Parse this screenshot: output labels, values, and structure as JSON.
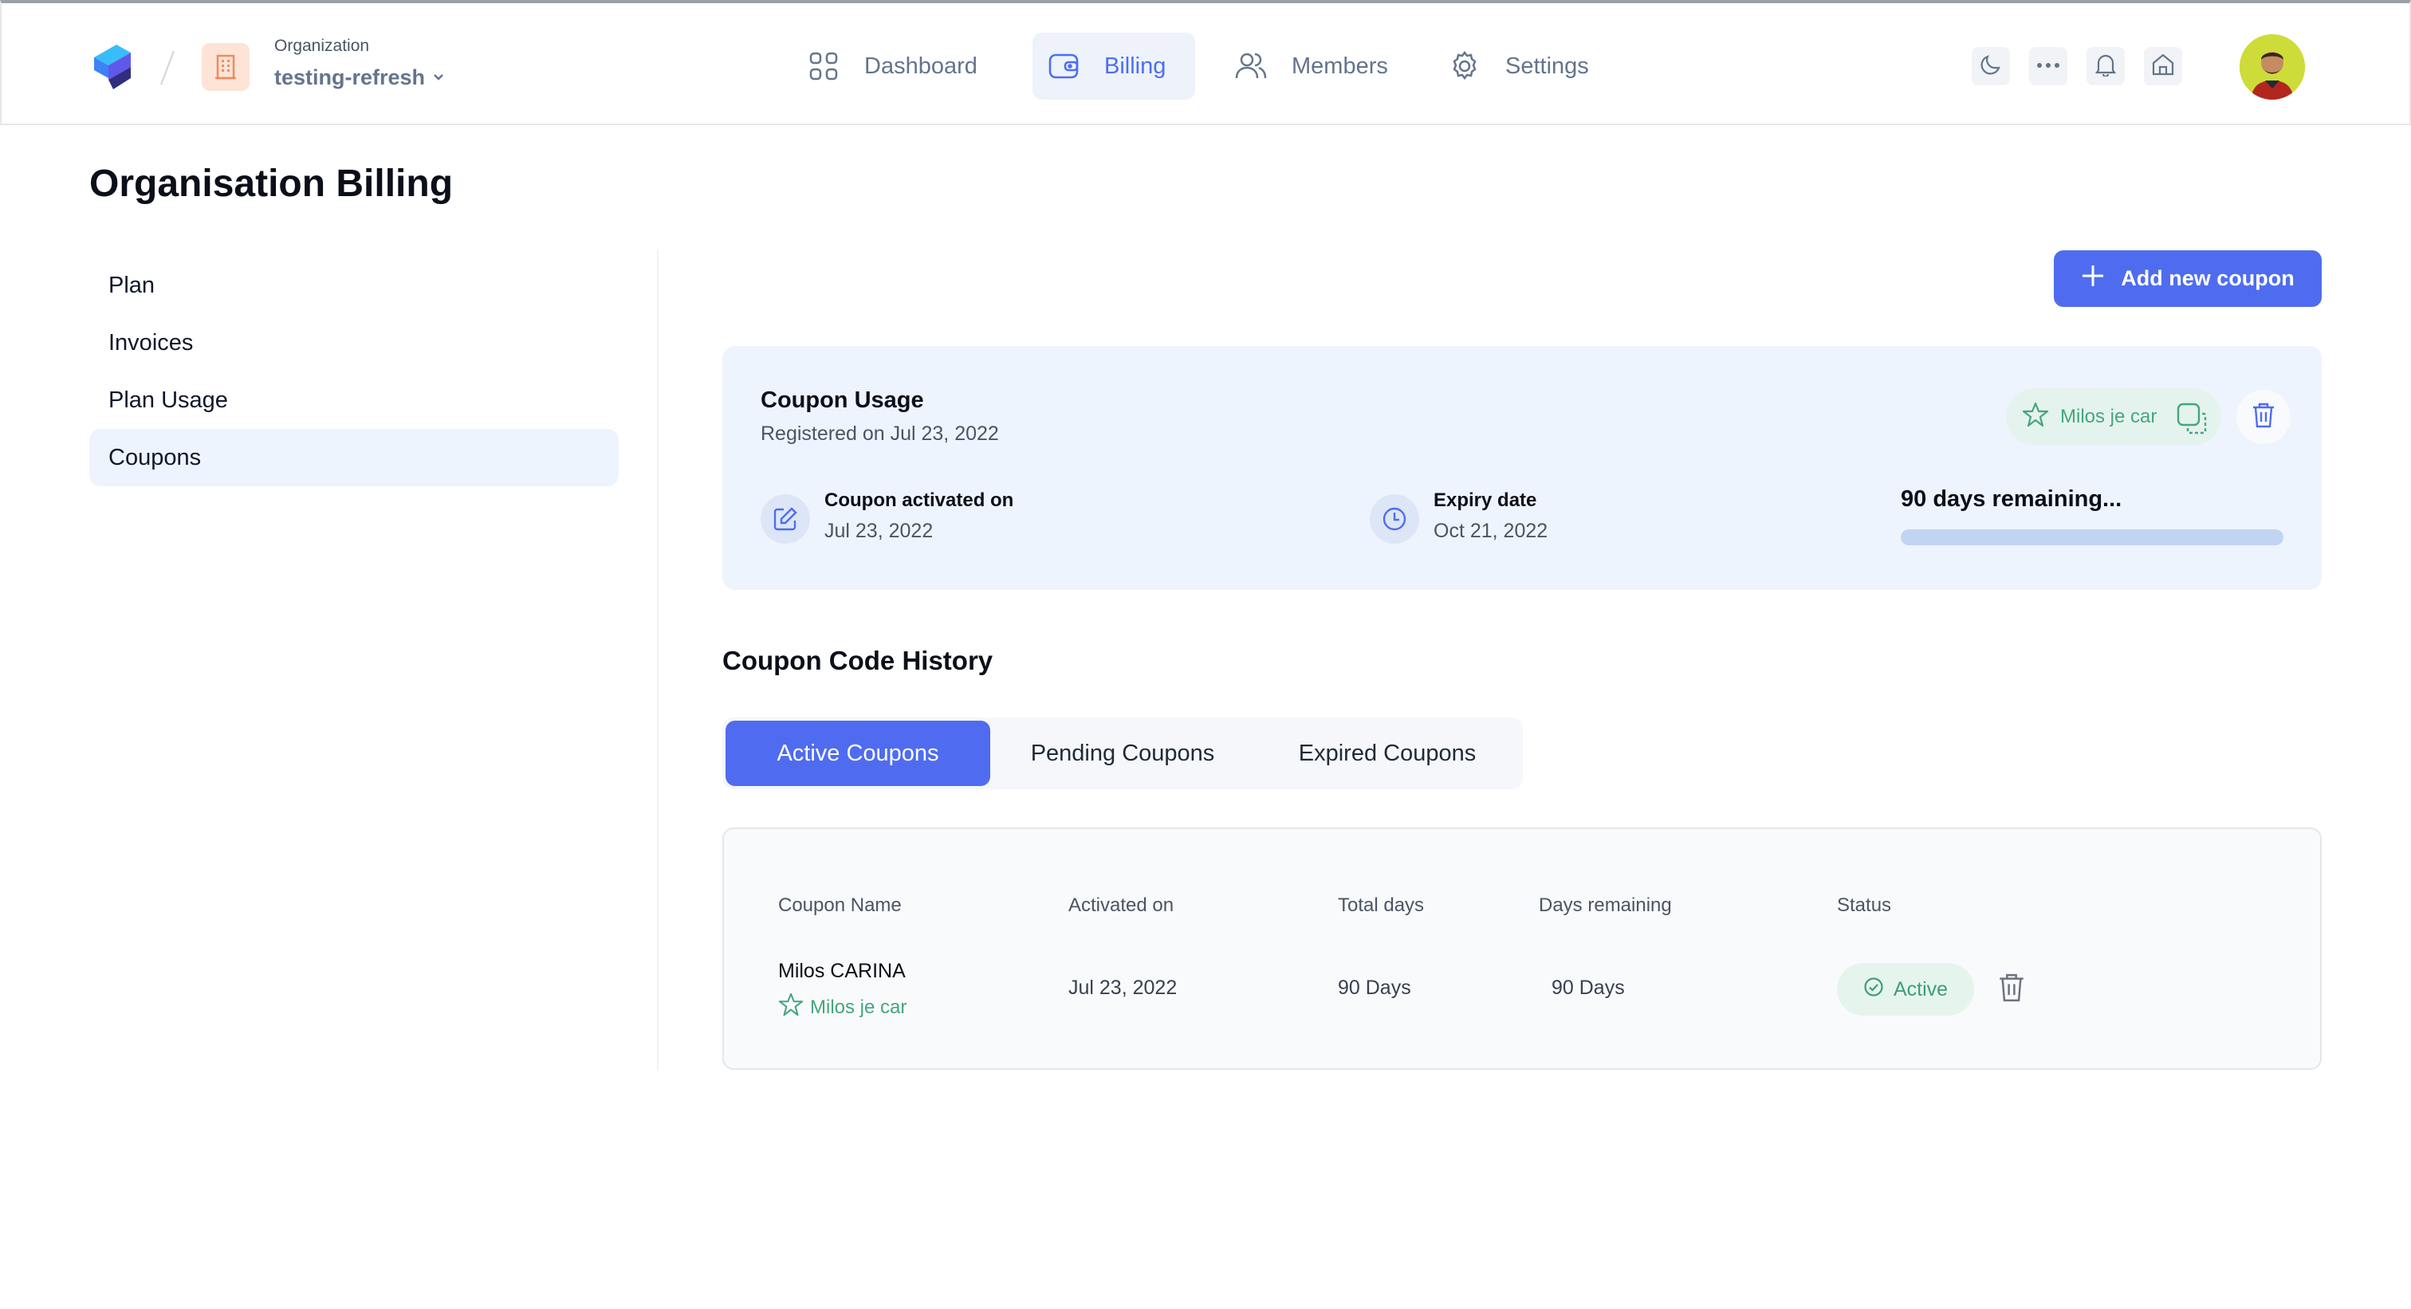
{
  "header": {
    "org_label": "Organization",
    "org_name": "testing-refresh",
    "nav": [
      {
        "label": "Dashboard",
        "icon": "grid-icon"
      },
      {
        "label": "Billing",
        "icon": "wallet-icon",
        "active": true
      },
      {
        "label": "Members",
        "icon": "users-icon"
      },
      {
        "label": "Settings",
        "icon": "gear-icon"
      }
    ],
    "controls": [
      "moon-icon",
      "more-icon",
      "bell-icon",
      "home-icon"
    ]
  },
  "page": {
    "title": "Organisation Billing"
  },
  "sidebar": {
    "items": [
      {
        "label": "Plan"
      },
      {
        "label": "Invoices"
      },
      {
        "label": "Plan Usage"
      },
      {
        "label": "Coupons",
        "active": true
      }
    ]
  },
  "actions": {
    "add_coupon_label": "Add new coupon"
  },
  "usage": {
    "title": "Coupon Usage",
    "registered": "Registered on Jul 23, 2022",
    "code": "Milos je car",
    "activated_label": "Coupon activated on",
    "activated_value": "Jul 23, 2022",
    "expiry_label": "Expiry date",
    "expiry_value": "Oct 21, 2022",
    "remaining_text": "90 days remaining...",
    "remaining_fraction": 1.0
  },
  "history": {
    "title": "Coupon Code History",
    "tabs": [
      {
        "label": "Active Coupons",
        "active": true
      },
      {
        "label": "Pending Coupons"
      },
      {
        "label": "Expired Coupons"
      }
    ],
    "columns": [
      "Coupon Name",
      "Activated on",
      "Total days",
      "Days remaining",
      "Status"
    ],
    "rows": [
      {
        "name": "Milos CARINA",
        "code": "Milos je car",
        "activated_on": "Jul 23, 2022",
        "total_days": "90 Days",
        "days_remaining": "90 Days",
        "status": "Active"
      }
    ]
  },
  "colors": {
    "accent": "#4f6cf0",
    "success": "#45a67e",
    "card_bg": "#eef4fd"
  }
}
